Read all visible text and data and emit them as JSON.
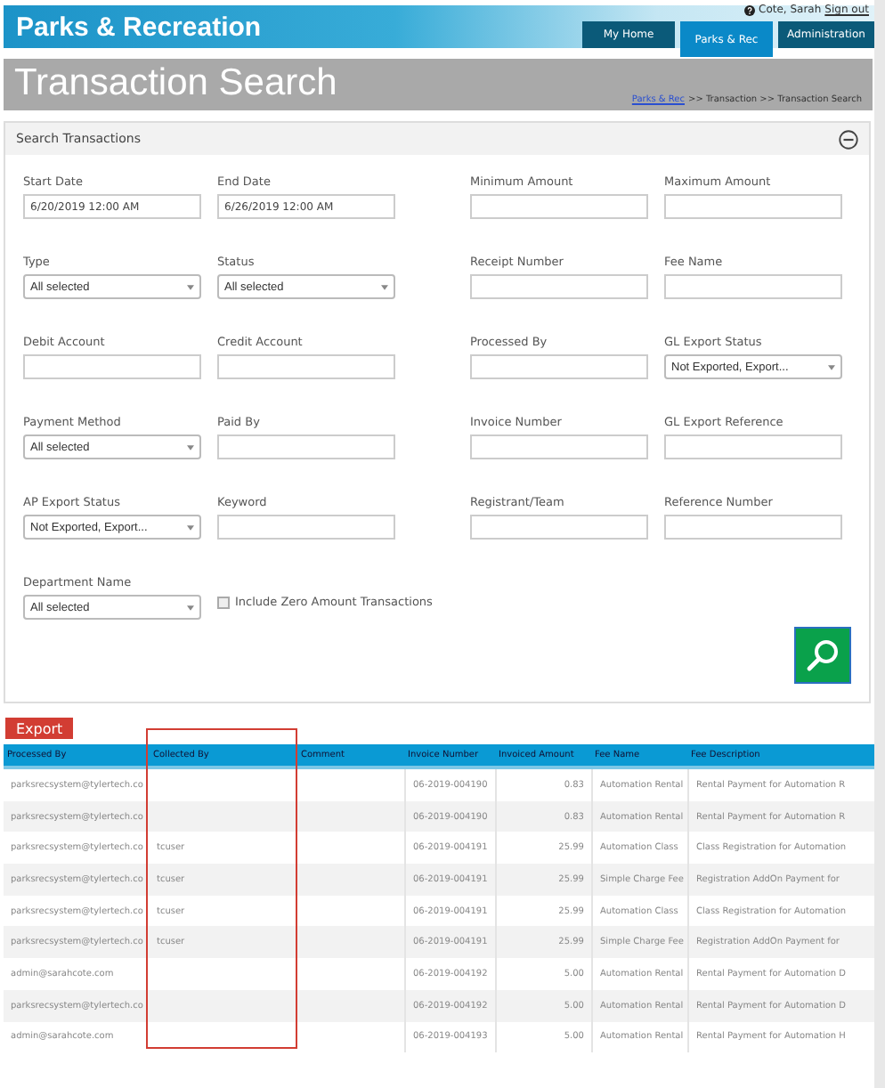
{
  "header": {
    "app_title": "Parks & Recreation",
    "user": "Cote, Sarah",
    "sign_out": "Sign out",
    "tabs": [
      {
        "label": "My Home",
        "selected": false
      },
      {
        "label": "Parks & Rec",
        "selected": true
      },
      {
        "label": "Administration",
        "selected": false
      }
    ]
  },
  "page_title": "Transaction Search",
  "breadcrumb": {
    "link": "Parks & Rec",
    "rest": ">> Transaction >> Transaction Search"
  },
  "search_panel": {
    "title": "Search Transactions",
    "expanded": true,
    "rows": [
      [
        {
          "label": "Start Date",
          "kind": "text",
          "value": "6/20/2019 12:00 AM"
        },
        {
          "label": "End Date",
          "kind": "text",
          "value": "6/26/2019 12:00 AM"
        },
        {
          "label": "Minimum Amount",
          "kind": "text"
        },
        {
          "label": "Maximum Amount",
          "kind": "text"
        }
      ],
      [
        {
          "label": "Type",
          "kind": "select",
          "value": "All selected"
        },
        {
          "label": "Status",
          "kind": "select",
          "value": "All selected"
        },
        {
          "label": "Receipt Number",
          "kind": "text"
        },
        {
          "label": "Fee Name",
          "kind": "text"
        }
      ],
      [
        {
          "label": "Debit Account",
          "kind": "text"
        },
        {
          "label": "Credit Account",
          "kind": "text"
        },
        {
          "label": "Processed By",
          "kind": "text"
        },
        {
          "label": "GL Export Status",
          "kind": "select",
          "value": "Not Exported, Export..."
        }
      ],
      [
        {
          "label": "Payment Method",
          "kind": "select",
          "value": "All selected"
        },
        {
          "label": "Paid By",
          "kind": "text"
        },
        {
          "label": "Invoice Number",
          "kind": "text"
        },
        {
          "label": "GL Export Reference",
          "kind": "text"
        }
      ],
      [
        {
          "label": "AP Export Status",
          "kind": "select",
          "value": "Not Exported, Export..."
        },
        {
          "label": "Keyword",
          "kind": "text"
        },
        {
          "label": "Registrant/Team",
          "kind": "text"
        },
        {
          "label": "Reference Number",
          "kind": "text"
        }
      ],
      [
        {
          "label": "Department Name",
          "kind": "select",
          "value": "All selected"
        },
        {
          "label": "Include Zero Amount Transactions",
          "kind": "checkbox",
          "checked": false
        }
      ]
    ]
  },
  "export_button": "Export",
  "table": {
    "columns": [
      "Processed By",
      "Collected By",
      "Comment",
      "Invoice Number",
      "Invoiced Amount",
      "Fee Name",
      "Fee Description"
    ],
    "rows": [
      [
        "parksrecsystem@tylertech.co",
        "",
        "",
        "06-2019-004190",
        "0.83",
        "Automation Rental",
        "Rental Payment for Automation R"
      ],
      [
        "parksrecsystem@tylertech.co",
        "",
        "",
        "06-2019-004190",
        "0.83",
        "Automation Rental",
        "Rental Payment for Automation R"
      ],
      [
        "parksrecsystem@tylertech.co",
        "tcuser",
        "",
        "06-2019-004191",
        "25.99",
        "Automation Class",
        "Class Registration for Automation"
      ],
      [
        "parksrecsystem@tylertech.co",
        "tcuser",
        "",
        "06-2019-004191",
        "25.99",
        "Simple Charge Fee",
        "Registration AddOn Payment for"
      ],
      [
        "parksrecsystem@tylertech.co",
        "tcuser",
        "",
        "06-2019-004191",
        "25.99",
        "Automation Class",
        "Class Registration for Automation"
      ],
      [
        "parksrecsystem@tylertech.co",
        "tcuser",
        "",
        "06-2019-004191",
        "25.99",
        "Simple Charge Fee",
        "Registration AddOn Payment for"
      ],
      [
        "admin@sarahcote.com",
        "",
        "",
        "06-2019-004192",
        "5.00",
        "Automation Rental",
        "Rental Payment for Automation D"
      ],
      [
        "parksrecsystem@tylertech.co",
        "",
        "",
        "06-2019-004192",
        "5.00",
        "Automation Rental",
        "Rental Payment for Automation D"
      ],
      [
        "admin@sarahcote.com",
        "",
        "",
        "06-2019-004193",
        "5.00",
        "Automation Rental",
        "Rental Payment for Automation H"
      ]
    ]
  }
}
